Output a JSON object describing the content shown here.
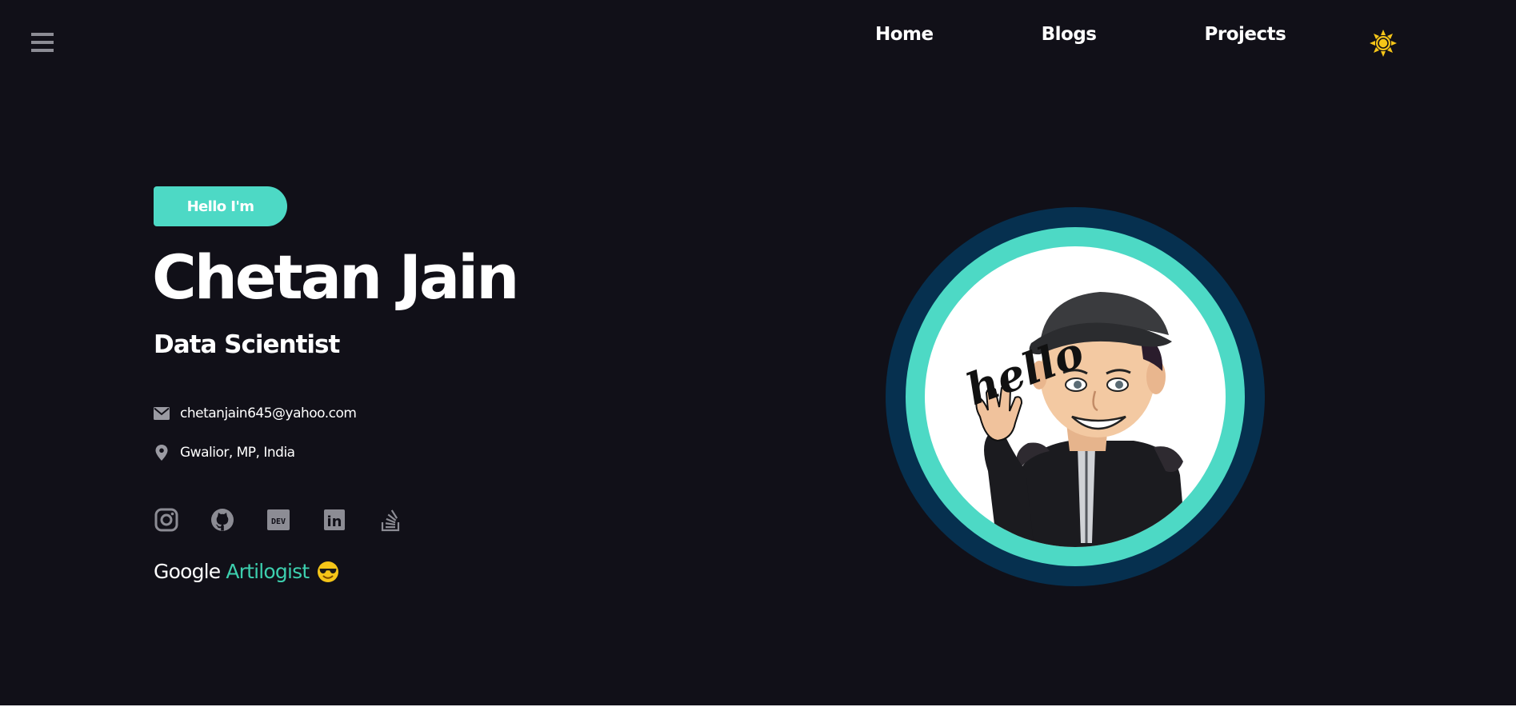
{
  "header": {
    "menu_icon": "hamburger-icon",
    "nav": [
      {
        "label": "Home"
      },
      {
        "label": "Blogs"
      },
      {
        "label": "Projects"
      }
    ],
    "theme_icon": "sun-icon",
    "theme_color": "#f5c518"
  },
  "hero": {
    "greeting": "Hello I'm",
    "name": "Chetan Jain",
    "role": "Data Scientist",
    "email": "chetanjain645@yahoo.com",
    "email_icon": "envelope-icon",
    "location": "Gwalior, MP, India",
    "location_icon": "map-pin-icon",
    "socials": [
      {
        "icon": "instagram-icon"
      },
      {
        "icon": "github-icon"
      },
      {
        "icon": "dev-icon",
        "text": "DEV"
      },
      {
        "icon": "linkedin-icon",
        "text": "in"
      },
      {
        "icon": "stackoverflow-icon"
      }
    ],
    "tagline_prefix": "Google",
    "tagline_accent": "Artilogist",
    "tagline_emoji": "sunglasses-emoji",
    "avatar_text": "hello",
    "avatar_icon": "bitmoji-avatar"
  },
  "colors": {
    "background": "#111018",
    "accent": "#4dd9c5",
    "accent_text": "#3dcfae",
    "avatar_outer_ring": "#06304f",
    "icon_gray": "#8c8c94"
  }
}
